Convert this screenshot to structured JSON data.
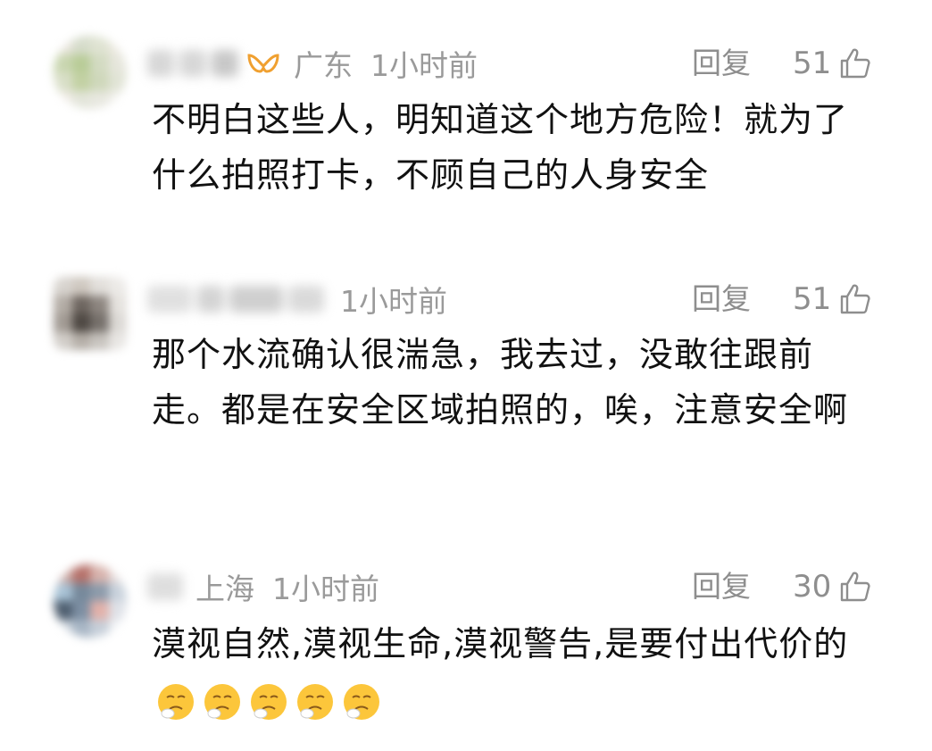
{
  "comments": [
    {
      "location": "广东",
      "time": "1小时前",
      "reply_label": "回复",
      "likes": "51",
      "text": "不明白这些人，明知道这个地方危险！就为了什么拍照打卡，不顾自己的人身安全"
    },
    {
      "location": "",
      "time": "1小时前",
      "reply_label": "回复",
      "likes": "51",
      "text": "那个水流确认很湍急，我去过，没敢往跟前走。都是在安全区域拍照的，唉，注意安全啊"
    },
    {
      "location": "上海",
      "time": "1小时前",
      "reply_label": "回复",
      "likes": "30",
      "text": "漠视自然,漠视生命,漠视警告,是要付出代价的"
    }
  ],
  "icons": {
    "like": "thumbs-up-icon",
    "badge": "vip-badge-icon",
    "emoji": "sick-face-emoji"
  },
  "colors": {
    "meta_text": "#9a9a9a",
    "body_text": "#111111",
    "badge": "#f0a030"
  }
}
